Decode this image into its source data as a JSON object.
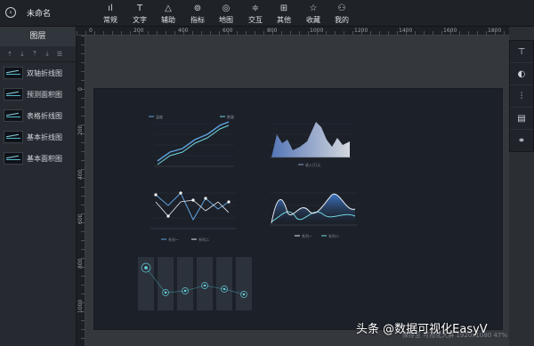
{
  "app": {
    "title": "未命名"
  },
  "toolbar": {
    "items": [
      {
        "label": "常规",
        "icon": "bar-chart-icon"
      },
      {
        "label": "文字",
        "icon": "text-icon"
      },
      {
        "label": "辅助",
        "icon": "shapes-icon"
      },
      {
        "label": "指标",
        "icon": "indicator-icon"
      },
      {
        "label": "地图",
        "icon": "map-pin-icon"
      },
      {
        "label": "交互",
        "icon": "sliders-icon"
      },
      {
        "label": "其他",
        "icon": "grid-icon"
      },
      {
        "label": "收藏",
        "icon": "star-icon"
      },
      {
        "label": "我的",
        "icon": "user-icon"
      }
    ]
  },
  "layers": {
    "title": "图层",
    "items": [
      {
        "label": "双轴折线图"
      },
      {
        "label": "预测面积图"
      },
      {
        "label": "表格折线图"
      },
      {
        "label": "基本折线图"
      },
      {
        "label": "基本面积图"
      }
    ]
  },
  "ruler": {
    "top_ticks": [
      "0",
      "200",
      "400",
      "600",
      "800",
      "1000",
      "1200",
      "1400",
      "1600",
      "1800"
    ],
    "left_ticks": [
      "0",
      "200",
      "400",
      "600",
      "800",
      "1000"
    ]
  },
  "canvas": {
    "chart1": {
      "legend": [
        "温度",
        "数量"
      ]
    },
    "chart2": {
      "legend": [
        "收入/万元"
      ]
    },
    "chart3": {
      "legend": [
        "系列一",
        "系列二"
      ]
    },
    "chart4": {
      "legend": [
        "系列一",
        "系列二"
      ]
    }
  },
  "right_tools": [
    "filter-icon",
    "palette-icon",
    "adjust-icon",
    "layout-icon",
    "link-icon"
  ],
  "status": {
    "text": "保存至 可视化大屏 1920x1080 47%"
  },
  "watermark": {
    "text": "头条 @数据可视化EasyV"
  },
  "colors": {
    "accent": "#4fb7c9",
    "canvas_bg": "#1c2028"
  }
}
